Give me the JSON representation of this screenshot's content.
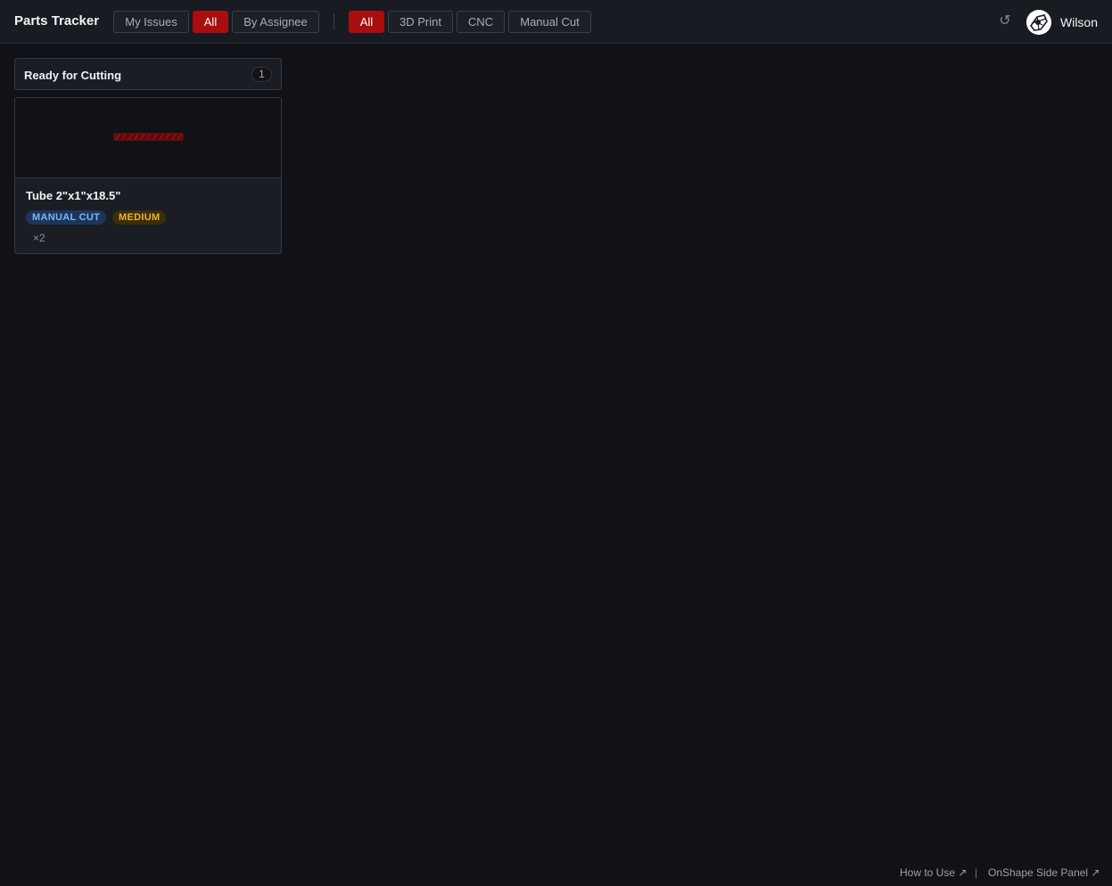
{
  "app": {
    "title": "Parts Tracker"
  },
  "view_filters": [
    {
      "label": "My Issues",
      "active": false
    },
    {
      "label": "All",
      "active": true
    },
    {
      "label": "By Assignee",
      "active": false
    }
  ],
  "type_filters": [
    {
      "label": "All",
      "active": true
    },
    {
      "label": "3D Print",
      "active": false
    },
    {
      "label": "CNC",
      "active": false
    },
    {
      "label": "Manual Cut",
      "active": false
    }
  ],
  "header_right": {
    "refresh_icon": "↺",
    "user_name": "Wilson"
  },
  "column": {
    "title": "Ready for Cutting",
    "count": "1"
  },
  "cards": [
    {
      "title": "Tube 2\"x1\"x18.5\"",
      "type_tag": "MANUAL CUT",
      "priority_tag": "MEDIUM",
      "quantity": "×2"
    }
  ],
  "footer": {
    "how_to_use": "How to Use ↗",
    "separator": "|",
    "side_panel": "OnShape Side Panel ↗"
  },
  "colors": {
    "accent": "#a80e0e",
    "background": "#111217",
    "panel": "#1a1d23",
    "tag_type_text": "#7ab6ff",
    "tag_priority_text": "#f0b429"
  }
}
